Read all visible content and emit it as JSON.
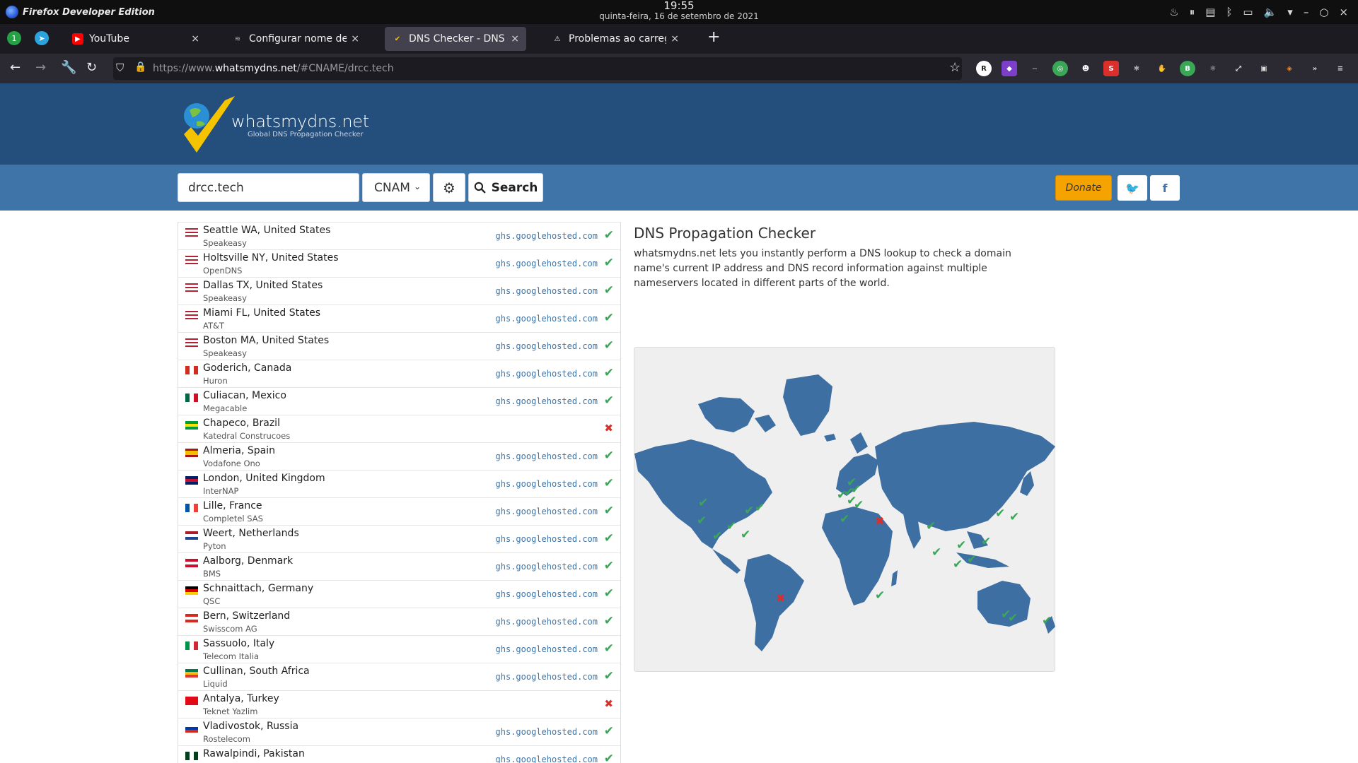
{
  "os": {
    "app_name": "Firefox Developer Edition",
    "time": "19:55",
    "date": "quinta-feira, 16 de setembro de 2021"
  },
  "tabs": [
    {
      "title": "YouTube",
      "active": false,
      "close": "×"
    },
    {
      "title": "Configurar nome de domin",
      "active": false,
      "close": "×"
    },
    {
      "title": "DNS Checker - DNS Propag",
      "active": true,
      "close": "×"
    },
    {
      "title": "Problemas ao carregar a p",
      "active": false,
      "close": "×"
    }
  ],
  "browser": {
    "url_prefix": "https://www.",
    "url_domain": "whatsmydns.net",
    "url_rest": "/#CNAME/drcc.tech"
  },
  "site": {
    "logo_text": "whatsmydns.net",
    "logo_sub": "Global DNS Propagation Checker"
  },
  "search": {
    "domain_value": "drcc.tech",
    "record_type": "CNAM",
    "search_label": "Search",
    "donate_label": "Donate"
  },
  "results": [
    {
      "location": "Seattle WA, United States",
      "provider": "Speakeasy",
      "result": "ghs.googlehosted.com",
      "status": "ok",
      "flag": "us"
    },
    {
      "location": "Holtsville NY, United States",
      "provider": "OpenDNS",
      "result": "ghs.googlehosted.com",
      "status": "ok",
      "flag": "us"
    },
    {
      "location": "Dallas TX, United States",
      "provider": "Speakeasy",
      "result": "ghs.googlehosted.com",
      "status": "ok",
      "flag": "us"
    },
    {
      "location": "Miami FL, United States",
      "provider": "AT&T",
      "result": "ghs.googlehosted.com",
      "status": "ok",
      "flag": "us"
    },
    {
      "location": "Boston MA, United States",
      "provider": "Speakeasy",
      "result": "ghs.googlehosted.com",
      "status": "ok",
      "flag": "us"
    },
    {
      "location": "Goderich, Canada",
      "provider": "Huron",
      "result": "ghs.googlehosted.com",
      "status": "ok",
      "flag": "ca"
    },
    {
      "location": "Culiacan, Mexico",
      "provider": "Megacable",
      "result": "ghs.googlehosted.com",
      "status": "ok",
      "flag": "mx"
    },
    {
      "location": "Chapeco, Brazil",
      "provider": "Katedral Construcoes",
      "result": "",
      "status": "fail",
      "flag": "br"
    },
    {
      "location": "Almeria, Spain",
      "provider": "Vodafone Ono",
      "result": "ghs.googlehosted.com",
      "status": "ok",
      "flag": "es"
    },
    {
      "location": "London, United Kingdom",
      "provider": "InterNAP",
      "result": "ghs.googlehosted.com",
      "status": "ok",
      "flag": "gb"
    },
    {
      "location": "Lille, France",
      "provider": "Completel SAS",
      "result": "ghs.googlehosted.com",
      "status": "ok",
      "flag": "fr"
    },
    {
      "location": "Weert, Netherlands",
      "provider": "Pyton",
      "result": "ghs.googlehosted.com",
      "status": "ok",
      "flag": "nl"
    },
    {
      "location": "Aalborg, Denmark",
      "provider": "BMS",
      "result": "ghs.googlehosted.com",
      "status": "ok",
      "flag": "dk"
    },
    {
      "location": "Schnaittach, Germany",
      "provider": "QSC",
      "result": "ghs.googlehosted.com",
      "status": "ok",
      "flag": "de"
    },
    {
      "location": "Bern, Switzerland",
      "provider": "Swisscom AG",
      "result": "ghs.googlehosted.com",
      "status": "ok",
      "flag": "ch"
    },
    {
      "location": "Sassuolo, Italy",
      "provider": "Telecom Italia",
      "result": "ghs.googlehosted.com",
      "status": "ok",
      "flag": "it"
    },
    {
      "location": "Cullinan, South Africa",
      "provider": "Liquid",
      "result": "ghs.googlehosted.com",
      "status": "ok",
      "flag": "za"
    },
    {
      "location": "Antalya, Turkey",
      "provider": "Teknet Yazlim",
      "result": "",
      "status": "fail",
      "flag": "tr"
    },
    {
      "location": "Vladivostok, Russia",
      "provider": "Rostelecom",
      "result": "ghs.googlehosted.com",
      "status": "ok",
      "flag": "ru"
    },
    {
      "location": "Rawalpindi, Pakistan",
      "provider": "",
      "result": "ghs.googlehosted.com",
      "status": "ok",
      "flag": "pk"
    }
  ],
  "info": {
    "title": "DNS Propagation Checker",
    "description": "whatsmydns.net lets you instantly perform a DNS lookup to check a domain name's current IP address and DNS record information against multiple nameservers located in different parts of the world."
  },
  "colors": {
    "header": "#244e7c",
    "search_band": "#3e74a7",
    "ok": "#3aa757",
    "fail": "#d9302c",
    "donate": "#f5a300"
  }
}
